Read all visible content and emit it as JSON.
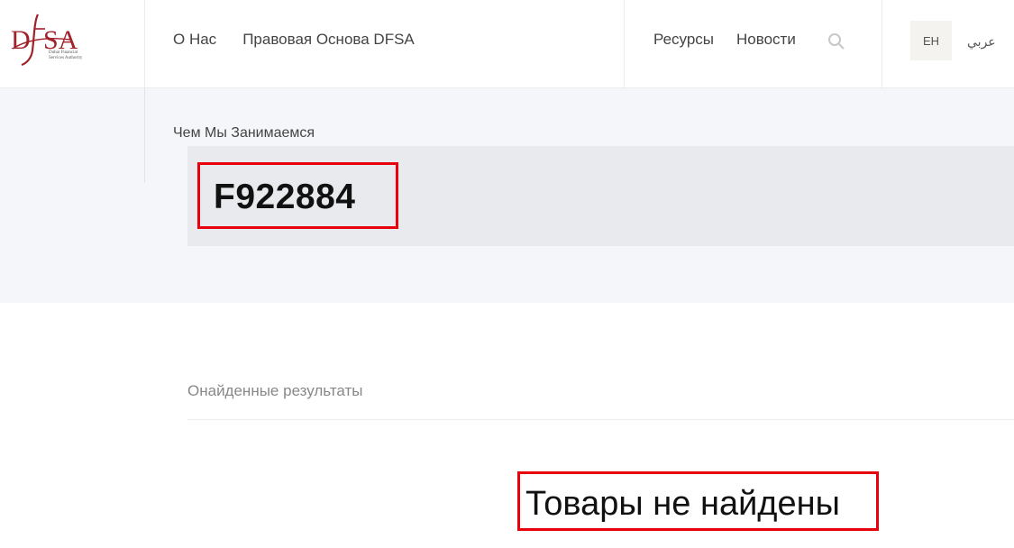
{
  "logo": {
    "mark": "DFSA",
    "subtitle_lines": [
      "Dubai Financial",
      "Services Authority"
    ],
    "color": "#a0222a"
  },
  "nav": {
    "left": [
      "О Нас",
      "Правовая Основа DFSA"
    ],
    "right": [
      "Ресурсы",
      "Новости"
    ],
    "search_icon": "search-icon"
  },
  "lang": {
    "en": "EH",
    "ar": "عربي"
  },
  "breadcrumb": "Чем Мы Занимаемся",
  "search": {
    "query": "F922884"
  },
  "results": {
    "label": "Онайденные результаты",
    "empty_message": "Товары не найдены"
  },
  "colors": {
    "highlight": "#e8000c",
    "hero_bg": "#f5f6f9",
    "panel_bg": "#e9eaee"
  }
}
